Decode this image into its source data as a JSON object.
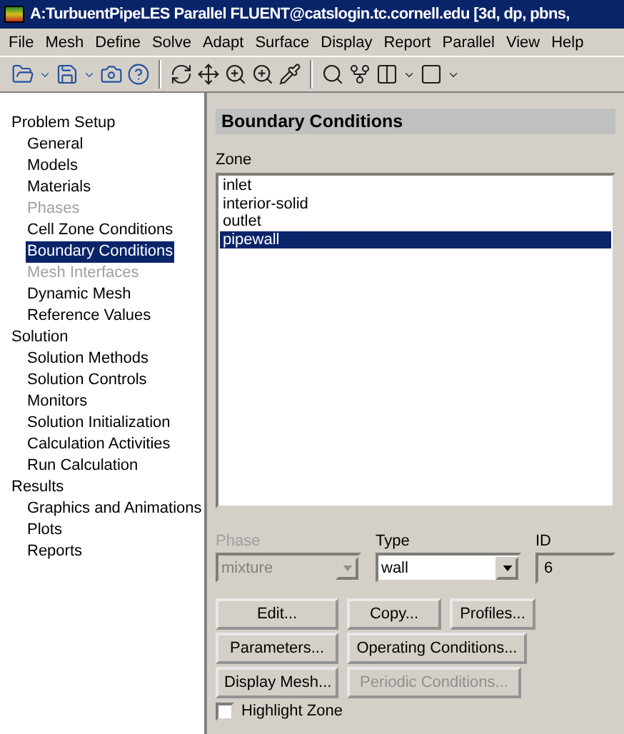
{
  "window": {
    "title": "A:TurbuentPipeLES Parallel FLUENT@catslogin.tc.cornell.edu  [3d, dp, pbns,"
  },
  "menu": [
    "File",
    "Mesh",
    "Define",
    "Solve",
    "Adapt",
    "Surface",
    "Display",
    "Report",
    "Parallel",
    "View",
    "Help"
  ],
  "tree": [
    {
      "label": "Problem Setup",
      "children": [
        {
          "label": "General",
          "disabled": false,
          "selected": false
        },
        {
          "label": "Models",
          "disabled": false,
          "selected": false
        },
        {
          "label": "Materials",
          "disabled": false,
          "selected": false
        },
        {
          "label": "Phases",
          "disabled": true,
          "selected": false
        },
        {
          "label": "Cell Zone Conditions",
          "disabled": false,
          "selected": false
        },
        {
          "label": "Boundary Conditions",
          "disabled": false,
          "selected": true
        },
        {
          "label": "Mesh Interfaces",
          "disabled": true,
          "selected": false
        },
        {
          "label": "Dynamic Mesh",
          "disabled": false,
          "selected": false
        },
        {
          "label": "Reference Values",
          "disabled": false,
          "selected": false
        }
      ]
    },
    {
      "label": "Solution",
      "children": [
        {
          "label": "Solution Methods",
          "disabled": false,
          "selected": false
        },
        {
          "label": "Solution Controls",
          "disabled": false,
          "selected": false
        },
        {
          "label": "Monitors",
          "disabled": false,
          "selected": false
        },
        {
          "label": "Solution Initialization",
          "disabled": false,
          "selected": false
        },
        {
          "label": "Calculation Activities",
          "disabled": false,
          "selected": false
        },
        {
          "label": "Run Calculation",
          "disabled": false,
          "selected": false
        }
      ]
    },
    {
      "label": "Results",
      "children": [
        {
          "label": "Graphics and Animations",
          "disabled": false,
          "selected": false
        },
        {
          "label": "Plots",
          "disabled": false,
          "selected": false
        },
        {
          "label": "Reports",
          "disabled": false,
          "selected": false
        }
      ]
    }
  ],
  "panel": {
    "title": "Boundary Conditions",
    "zone_label": "Zone",
    "zones": [
      {
        "label": "inlet",
        "selected": false
      },
      {
        "label": "interior-solid",
        "selected": false
      },
      {
        "label": "outlet",
        "selected": false
      },
      {
        "label": "pipewall",
        "selected": true
      }
    ],
    "phase": {
      "label": "Phase",
      "value": "mixture",
      "disabled": true
    },
    "type": {
      "label": "Type",
      "value": "wall",
      "disabled": false
    },
    "id": {
      "label": "ID",
      "value": "6"
    },
    "button_rows": [
      [
        {
          "label": "Edit...",
          "disabled": false
        },
        {
          "label": "Copy...",
          "disabled": false
        },
        {
          "label": "Profiles...",
          "disabled": false
        }
      ],
      [
        {
          "label": "Parameters...",
          "disabled": false
        },
        {
          "label": "Operating Conditions...",
          "disabled": false
        }
      ],
      [
        {
          "label": "Display Mesh...",
          "disabled": false
        },
        {
          "label": "Periodic Conditions...",
          "disabled": true
        }
      ]
    ],
    "highlight": {
      "label": "Highlight Zone",
      "checked": false
    }
  }
}
